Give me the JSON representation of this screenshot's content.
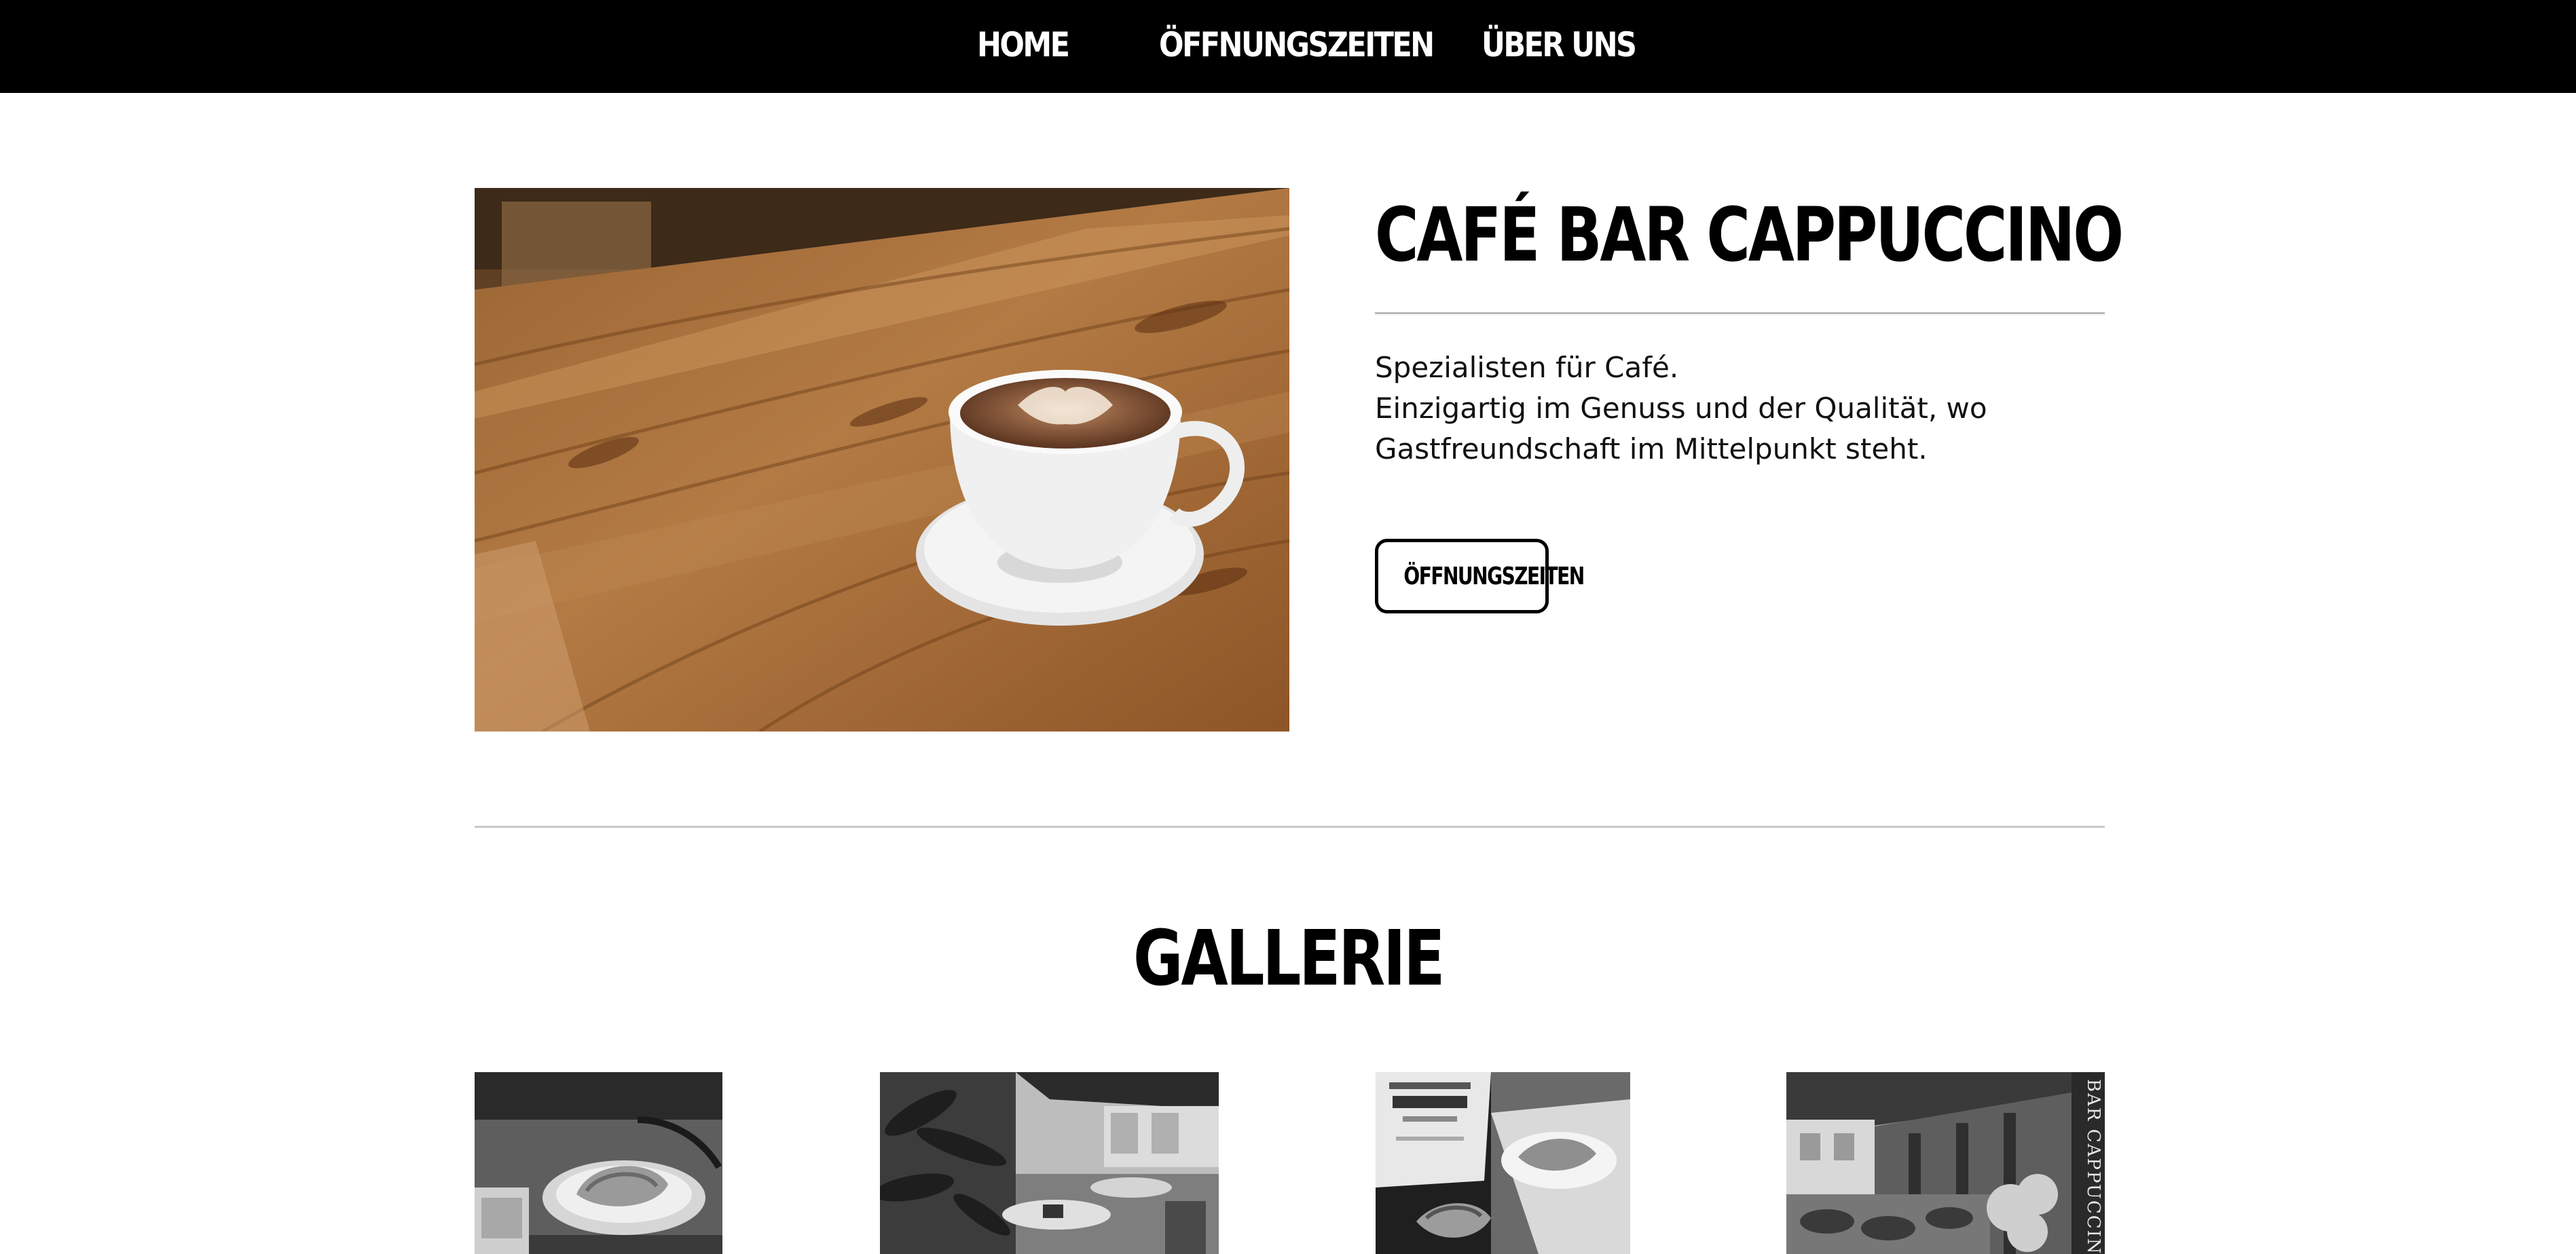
{
  "nav": {
    "items": [
      {
        "label": "HOME"
      },
      {
        "label": "ÖFFNUNGSZEITEN"
      },
      {
        "label": "ÜBER UNS"
      }
    ]
  },
  "hero": {
    "image_icon": "coffee-cup-photo",
    "title": "CAFÉ BAR CAPPUCCINO",
    "text_lines": [
      "Spezialisten für Café.",
      "Einzigartig im Genuss und der Qualität, wo",
      "Gastfreundschaft im Mittelpunkt steht."
    ],
    "button_label": "ÖFFNUNGSZEITEN"
  },
  "gallery": {
    "title": "GALLERIE",
    "tiles": [
      {
        "icon": "toast-plate-photo"
      },
      {
        "icon": "terrace-umbrella-photo"
      },
      {
        "icon": "cafe-menu-photo"
      },
      {
        "icon": "street-terrace-photo",
        "sign_text": "BAR CAPPUCCINO"
      }
    ]
  },
  "colors": {
    "nav_background": "#000000",
    "nav_text": "#ffffff",
    "text": "#000000",
    "rule": "#b7b7b7"
  }
}
